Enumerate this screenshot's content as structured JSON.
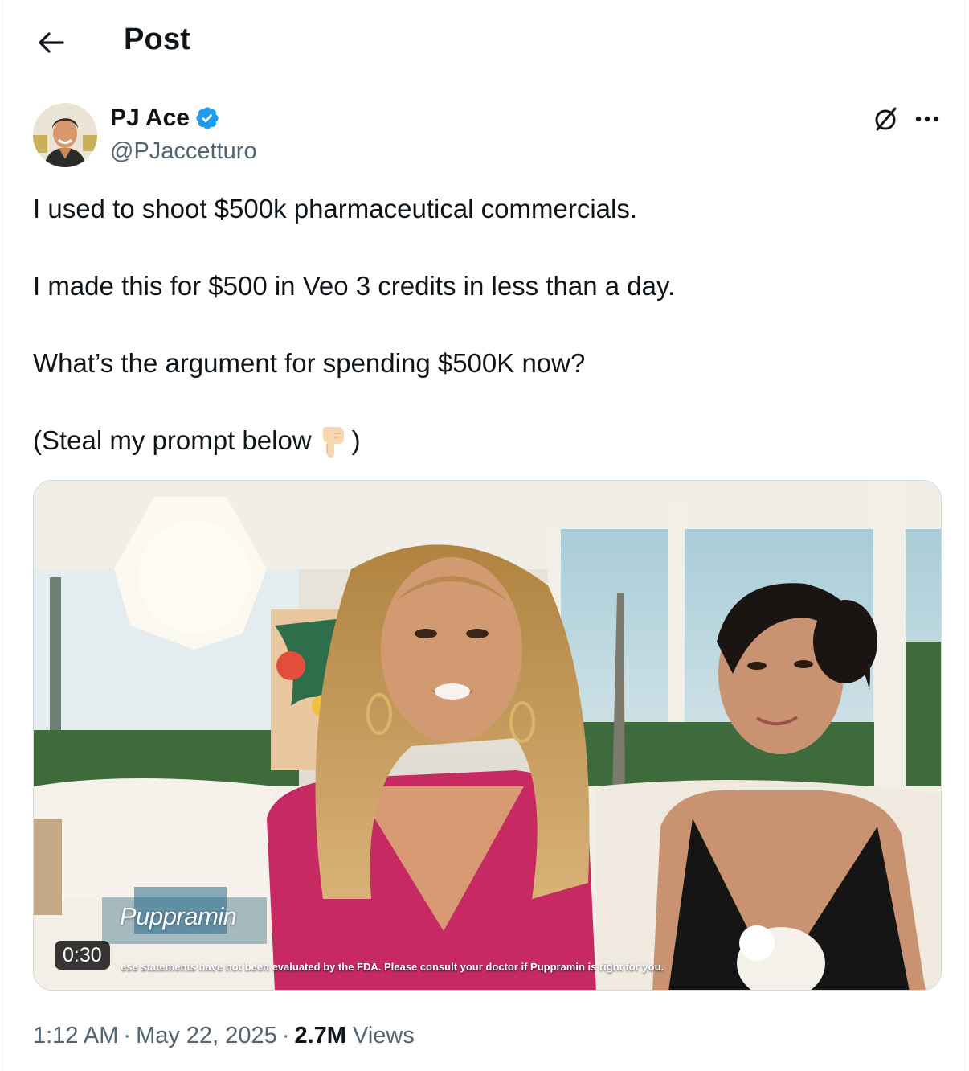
{
  "header": {
    "title": "Post"
  },
  "author": {
    "display_name": "PJ Ace",
    "handle": "@PJaccetturo",
    "verified": true
  },
  "tweet": {
    "paragraphs": [
      "I used to shoot $500k pharmaceutical commercials.",
      "I made this for $500 in Veo 3 credits in less than a day.",
      "What’s the argument for spending $500K now?",
      "(Steal my prompt below"
    ],
    "closing_paren": ")",
    "emoji": "backhand-index-pointing-down"
  },
  "media": {
    "duration": "0:30",
    "product_name": "Puppramin",
    "disclaimer": "ese statements have not been evaluated by the FDA. Please consult your doctor if Puppramin is right for you."
  },
  "meta": {
    "time": "1:12 AM",
    "date": "May 22, 2025",
    "separator": "·",
    "views_count": "2.7M",
    "views_label": "Views"
  },
  "colors": {
    "text": "#0f1419",
    "secondary": "#536471",
    "verified": "#1d9bf0"
  }
}
